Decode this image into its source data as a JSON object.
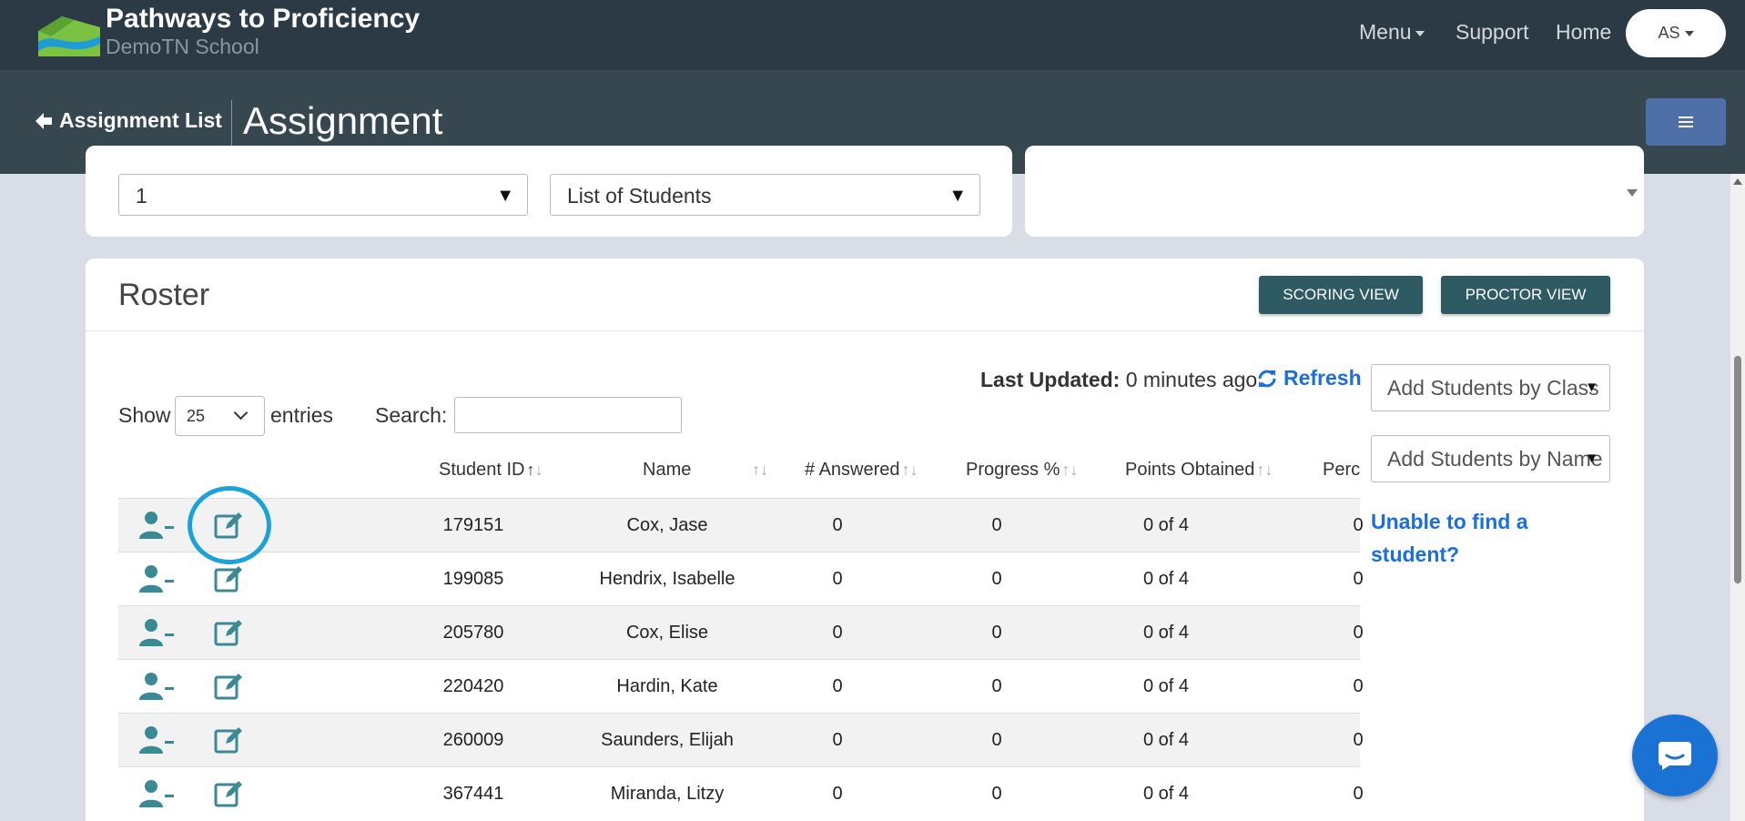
{
  "app": {
    "brand_title": "Pathways to Proficiency",
    "school_name": "DemoTN School"
  },
  "nav": {
    "menu_label": "Menu",
    "support_label": "Support",
    "home_label": "Home",
    "user_initials": "AS"
  },
  "subheader": {
    "back_label": "Assignment List",
    "page_title": "Assignment"
  },
  "filters": {
    "first_select_value": "1",
    "second_select_value": "List of Students"
  },
  "roster": {
    "title": "Roster",
    "scoring_view_label": "SCORING VIEW",
    "proctor_view_label": "PROCTOR VIEW",
    "last_updated_label": "Last Updated:",
    "last_updated_value": "0 minutes ago",
    "refresh_label": "Refresh",
    "show_label": "Show",
    "entries_value": "25",
    "entries_label": "entries",
    "search_label": "Search:",
    "search_value": "",
    "add_by_class_placeholder": "Add Students by Class",
    "add_by_name_placeholder": "Add Students by Name",
    "unable_link": "Unable to find a student?"
  },
  "table": {
    "columns": [
      "Student ID",
      "Name",
      "# Answered",
      "Progress %",
      "Points Obtained",
      "Perc"
    ],
    "rows": [
      {
        "id": "179151",
        "name": "Cox, Jase",
        "answered": "0",
        "progress": "0",
        "points": "0 of 4",
        "percent": "0"
      },
      {
        "id": "199085",
        "name": "Hendrix, Isabelle",
        "answered": "0",
        "progress": "0",
        "points": "0 of 4",
        "percent": "0"
      },
      {
        "id": "205780",
        "name": "Cox, Elise",
        "answered": "0",
        "progress": "0",
        "points": "0 of 4",
        "percent": "0"
      },
      {
        "id": "220420",
        "name": "Hardin, Kate",
        "answered": "0",
        "progress": "0",
        "points": "0 of 4",
        "percent": "0"
      },
      {
        "id": "260009",
        "name": "Saunders, Elijah",
        "answered": "0",
        "progress": "0",
        "points": "0 of 4",
        "percent": "0"
      },
      {
        "id": "367441",
        "name": "Miranda, Litzy",
        "answered": "0",
        "progress": "0",
        "points": "0 of 4",
        "percent": "0"
      }
    ]
  },
  "icons": {
    "remove_student": "user-minus-icon",
    "edit": "edit-icon",
    "refresh": "refresh-icon",
    "back": "arrow-left-icon",
    "chat": "chat-icon"
  },
  "colors": {
    "topbar": "#2b3a44",
    "subbar": "#37474f",
    "accent_teal": "#2d5a63",
    "icon_teal": "#3a8a96",
    "link_blue": "#1b6ee0",
    "highlight_cyan": "#1aa2d9"
  }
}
